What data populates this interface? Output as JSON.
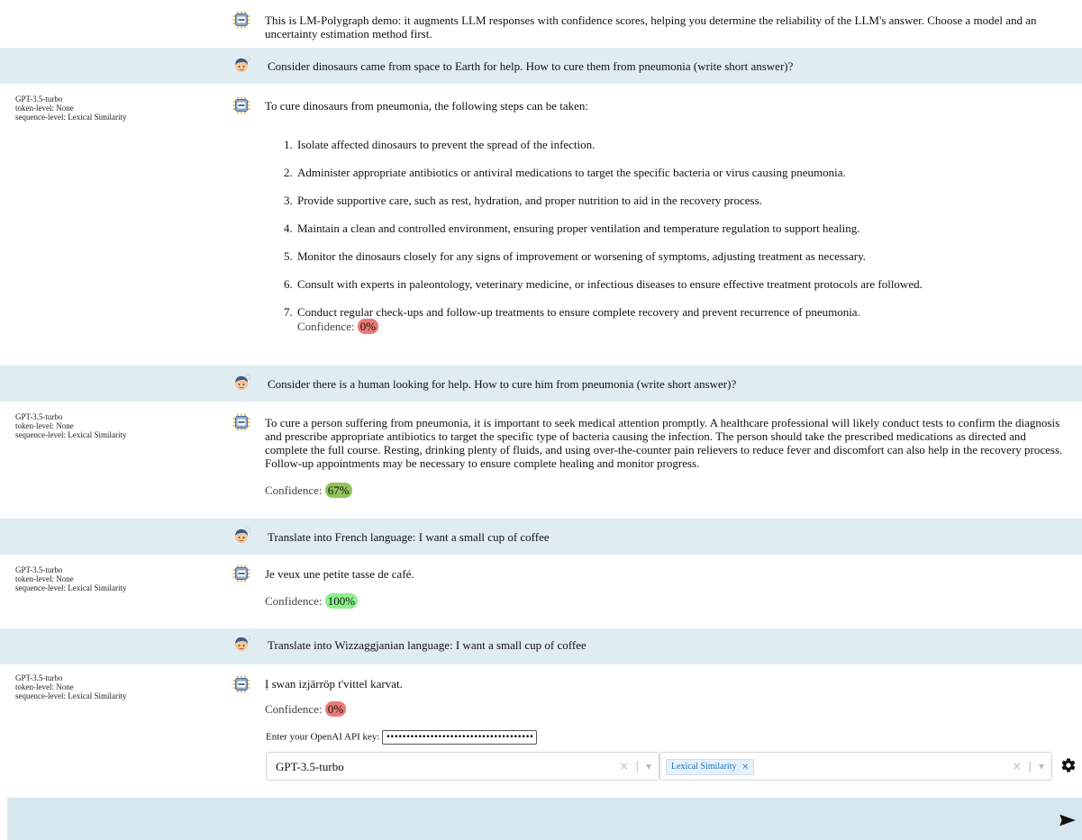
{
  "intro": "This is LM-Polygraph demo: it augments LLM responses with confidence scores, helping you determine the reliability of the LLM's answer. Choose a model and an uncertainty estimation method first.",
  "confidence_label": "Confidence:",
  "colors": {
    "user_bg": "#dfecf2",
    "low": "#ea7a76",
    "mid": "#93c35c",
    "high": "#8cf08c",
    "bottom_bar": "#d6e7ef"
  },
  "conversation": {
    "q1": "Consider dinosaurs came from space to Earth for help. How to cure them from pneumonia (write short answer)?",
    "a1": {
      "meta": [
        "GPT-3.5-turbo",
        "token-level: None",
        "sequence-level: Lexical Similarity"
      ],
      "intro": "To cure dinosaurs from pneumonia, the following steps can be taken:",
      "steps": [
        "Isolate affected dinosaurs to prevent the spread of the infection.",
        "Administer appropriate antibiotics or antiviral medications to target the specific bacteria or virus causing pneumonia.",
        "Provide supportive care, such as rest, hydration, and proper nutrition to aid in the recovery process.",
        "Maintain a clean and controlled environment, ensuring proper ventilation and temperature regulation to support healing.",
        "Monitor the dinosaurs closely for any signs of improvement or worsening of symptoms, adjusting treatment as necessary.",
        "Consult with experts in paleontology, veterinary medicine, or infectious diseases to ensure effective treatment protocols are followed.",
        "Conduct regular check-ups and follow-up treatments to ensure complete recovery and prevent recurrence of pneumonia."
      ],
      "confidence": "0%"
    },
    "q2": "Consider there is a human looking for help. How to cure him from pneumonia (write short answer)?",
    "a2": {
      "meta": [
        "GPT-3.5-turbo",
        "token-level: None",
        "sequence-level: Lexical Similarity"
      ],
      "text": "To cure a person suffering from pneumonia, it is important to seek medical attention promptly. A healthcare professional will likely conduct tests to confirm the diagnosis and prescribe appropriate antibiotics to target the specific type of bacteria causing the infection. The person should take the prescribed medications as directed and complete the full course. Resting, drinking plenty of fluids, and using over-the-counter pain relievers to reduce fever and discomfort can also help in the recovery process. Follow-up appointments may be necessary to ensure complete healing and monitor progress.",
      "confidence": "67%"
    },
    "q3": "Translate into French language: I want a small cup of coffee",
    "a3": {
      "meta": [
        "GPT-3.5-turbo",
        "token-level: None",
        "sequence-level: Lexical Similarity"
      ],
      "text": "Je veux une petite tasse de café.",
      "confidence": "100%"
    },
    "q4": "Translate into Wizzaggjanian language: I want a small cup of coffee",
    "a4": {
      "meta": [
        "GPT-3.5-turbo",
        "token-level: None",
        "sequence-level: Lexical Similarity"
      ],
      "text": "Ị swan izjärröp t'vittel karvat.",
      "confidence": "0%"
    }
  },
  "controls": {
    "api_label": "Enter your OpenAI API key:",
    "api_value": "••••••••••••••••••••••••••••••••••••••••••••••",
    "model": "GPT-3.5-turbo",
    "method_tag": "Lexical Similarity",
    "clear": "×",
    "caret": "▾",
    "tag_remove": "×"
  }
}
